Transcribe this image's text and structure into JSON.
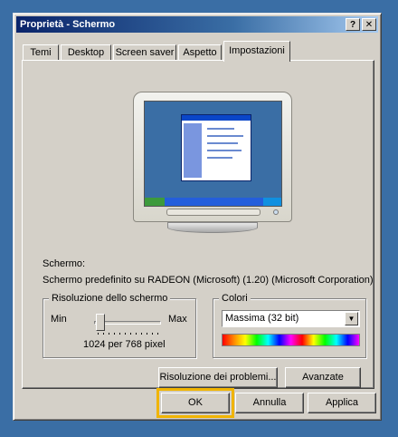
{
  "window": {
    "title": "Proprietà - Schermo",
    "help_btn": "?",
    "close_btn": "✕"
  },
  "tabs": [
    {
      "label": "Temi"
    },
    {
      "label": "Desktop"
    },
    {
      "label": "Screen saver"
    },
    {
      "label": "Aspetto"
    },
    {
      "label": "Impostazioni"
    }
  ],
  "active_tab": "Impostazioni",
  "display": {
    "heading": "Schermo:",
    "value": "Schermo predefinito su RADEON (Microsoft) (1.20) (Microsoft Corporation)"
  },
  "resolution": {
    "group_title": "Risoluzione dello schermo",
    "min_label": "Min",
    "max_label": "Max",
    "value_text": "1024 per 768 pixel",
    "slider_level": 0.0
  },
  "colors": {
    "group_title": "Colori",
    "selected": "Massima (32 bit)"
  },
  "buttons": {
    "troubleshoot": "Risoluzione dei problemi...",
    "advanced": "Avanzate",
    "ok": "OK",
    "cancel": "Annulla",
    "apply": "Applica"
  }
}
